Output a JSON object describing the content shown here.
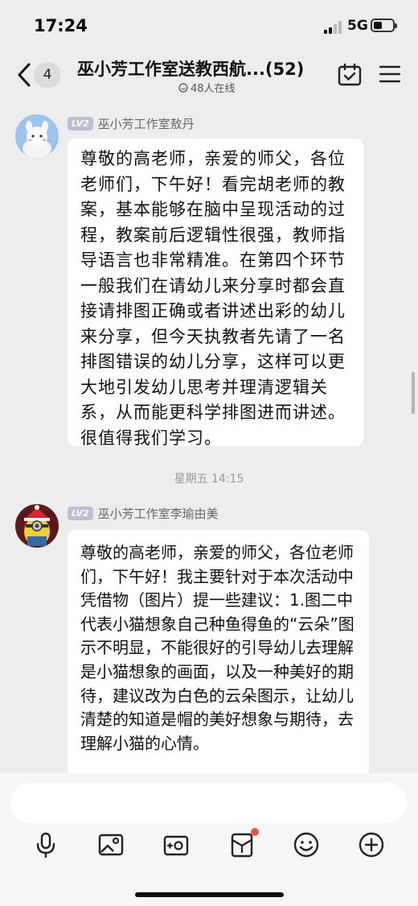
{
  "status_bar": {
    "time": "17:24",
    "network": "5G"
  },
  "nav": {
    "unread_count": "4",
    "title": "巫小芳工作室送教西航...(52)",
    "online": "48人在线"
  },
  "messages": [
    {
      "level": "LV2",
      "sender": "巫小芳工作室敖丹",
      "text": "尊敬的高老师，亲爱的师父，各位老师们，下午好！看完胡老师的教案，基本能够在脑中呈现活动的过程，教案前后逻辑性很强，教师指导语言也非常精准。在第四个环节一般我们在请幼儿来分享时都会直接请排图正确或者讲述出彩的幼儿来分享，但今天执教者先请了一名排图错误的幼儿分享，这样可以更大地引发幼儿思考并理清逻辑关系，从而能更科学排图进而讲述。很值得我们学习。"
    },
    {
      "level": "LV2",
      "sender": "巫小芳工作室李瑜由美",
      "text": "尊敬的高老师，亲爱的师父，各位老师们，下午好！我主要针对于本次活动中凭借物（图片）提一些建议：1.图二中代表小猫想象自己种鱼得鱼的“云朵”图示不明显，不能很好的引导幼儿去理解是小猫想象的画面，以及一种美好的期待，建议改为白色的云朵图示，让幼儿清楚的知道是帽的美好想象与期待，去理解小猫的心情。"
    }
  ],
  "timestamp": "星期五 14:15",
  "toolbar": [
    "microphone-icon",
    "image-icon",
    "camera-icon",
    "gift-icon",
    "emoji-icon",
    "add-icon"
  ],
  "colors": {
    "background": "#ededed",
    "bubble": "#ffffff",
    "badge": "#b8c0d1",
    "notification_dot": "#f2553f"
  }
}
